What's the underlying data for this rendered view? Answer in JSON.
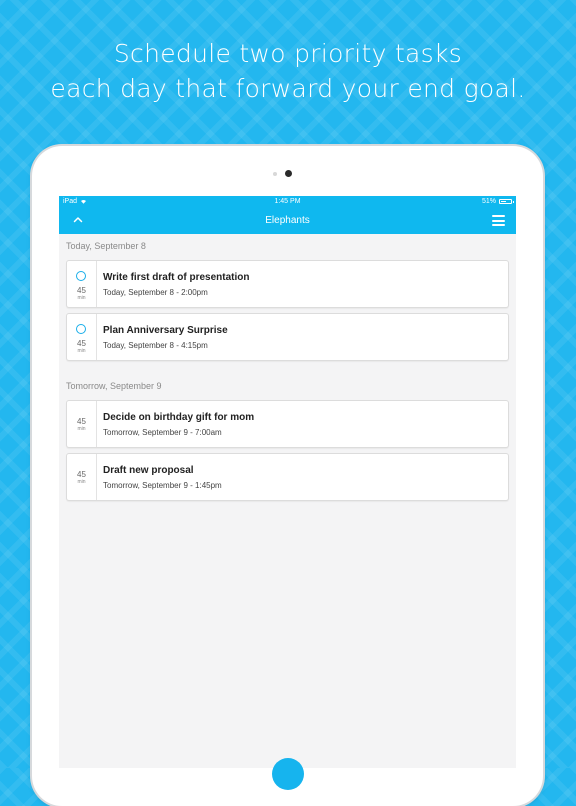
{
  "headline": {
    "line1": "Schedule two priority tasks",
    "line2": "each day that forward your end goal."
  },
  "status_bar": {
    "carrier": "iPad",
    "time": "1:45 PM",
    "battery_text": "51%",
    "battery_level": 0.51
  },
  "nav": {
    "title": "Elephants",
    "up_icon": "chevron-up-icon",
    "menu_icon": "hamburger-menu-icon"
  },
  "sections": [
    {
      "header": "Today, September 8",
      "tasks": [
        {
          "title": "Write first draft of presentation",
          "when": "Today, September 8 - 2:00pm",
          "duration": "45",
          "unit": "min",
          "checkbox": true
        },
        {
          "title": "Plan Anniversary Surprise",
          "when": "Today, September 8 - 4:15pm",
          "duration": "45",
          "unit": "min",
          "checkbox": true
        }
      ]
    },
    {
      "header": "Tomorrow, September 9",
      "tasks": [
        {
          "title": "Decide on birthday gift for mom",
          "when": "Tomorrow, September 9 - 7:00am",
          "duration": "45",
          "unit": "min",
          "checkbox": false
        },
        {
          "title": "Draft new proposal",
          "when": "Tomorrow, September 9 - 1:45pm",
          "duration": "45",
          "unit": "min",
          "checkbox": false
        }
      ]
    }
  ],
  "colors": {
    "background": "#23b7ef",
    "accent": "#0fb8ef",
    "screen_bg": "#f4f4f5"
  }
}
